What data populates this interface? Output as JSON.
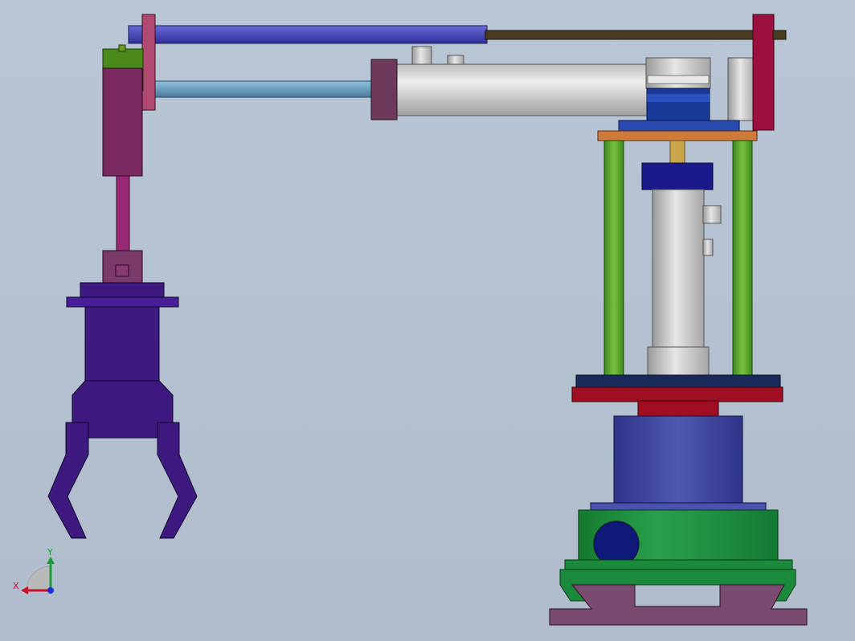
{
  "viewport": {
    "background_top": "#b8c6d6",
    "background_bottom": "#b0bccb"
  },
  "triad": {
    "x_label": "X",
    "y_label": "Y",
    "x_color": "#c8102e",
    "y_color": "#1a9e3a",
    "z_color": "#1c2fd6"
  },
  "colors": {
    "upper_rod": "#4848c0",
    "lower_rod": "#5f92b4",
    "guide_rod": "#4a3a22",
    "cylinder_body": "#cfcfcf",
    "end_plate_left": "#6e3a5c",
    "end_plate_right": "#9c1040",
    "gripper": "#3e1a80",
    "wrist_block": "#7a2a60",
    "column_green": "#5aa02c",
    "base_green": "#1c8a3c",
    "base_blue": "#3e46a0",
    "base_red": "#a00e22",
    "base_feet": "#7a4a70",
    "motor_blue": "#0f1a78",
    "top_plate_orange": "#d07a3a"
  }
}
